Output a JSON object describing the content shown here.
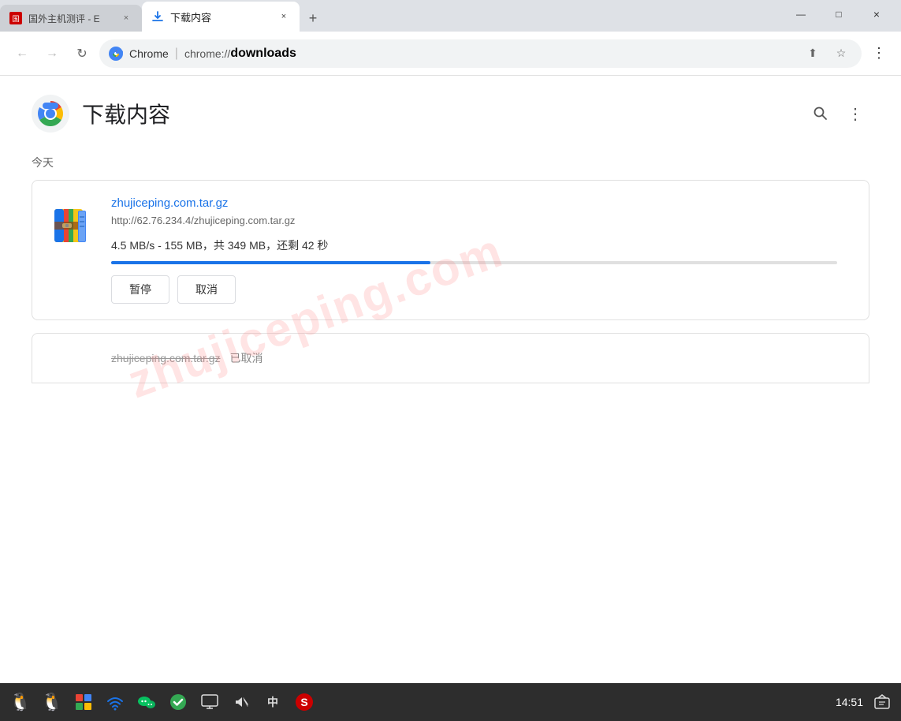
{
  "titlebar": {
    "tab1": {
      "title": "国外主机测评 - E",
      "favicon_text": "国",
      "close_label": "×"
    },
    "tab2": {
      "title": "下载内容",
      "close_label": "×",
      "new_tab_label": "+"
    },
    "window_controls": {
      "minimize": "—",
      "maximize": "□",
      "close": "×"
    }
  },
  "toolbar": {
    "back_icon": "←",
    "forward_icon": "→",
    "reload_icon": "↻",
    "domain": "Chrome",
    "separator": "|",
    "url_prefix": "chrome://",
    "url_path": "downloads",
    "share_icon": "⬆",
    "bookmark_icon": "☆",
    "menu_icon": "⋮"
  },
  "page": {
    "title": "下载内容",
    "search_icon": "🔍",
    "menu_icon": "⋮",
    "section_today": "今天",
    "watermark": "zhujiceping.com",
    "download1": {
      "filename": "zhujiceping.com.tar.gz",
      "url": "http://62.76.234.4/zhujiceping.com.tar.gz",
      "status": "4.5 MB/s - 155 MB，共 349 MB，还剩 42 秒",
      "progress_percent": 44,
      "btn_pause": "暂停",
      "btn_cancel": "取消"
    },
    "download2": {
      "filename": "zhujiceping.com.tar.gz",
      "status": "已取消"
    }
  },
  "taskbar": {
    "icons": [
      "🐧",
      "🐧",
      "🎨",
      "📶",
      "💬",
      "✅",
      "🖥",
      "🔊",
      "中",
      "🅂"
    ],
    "time": "14:51",
    "notification_icon": "🗨"
  }
}
